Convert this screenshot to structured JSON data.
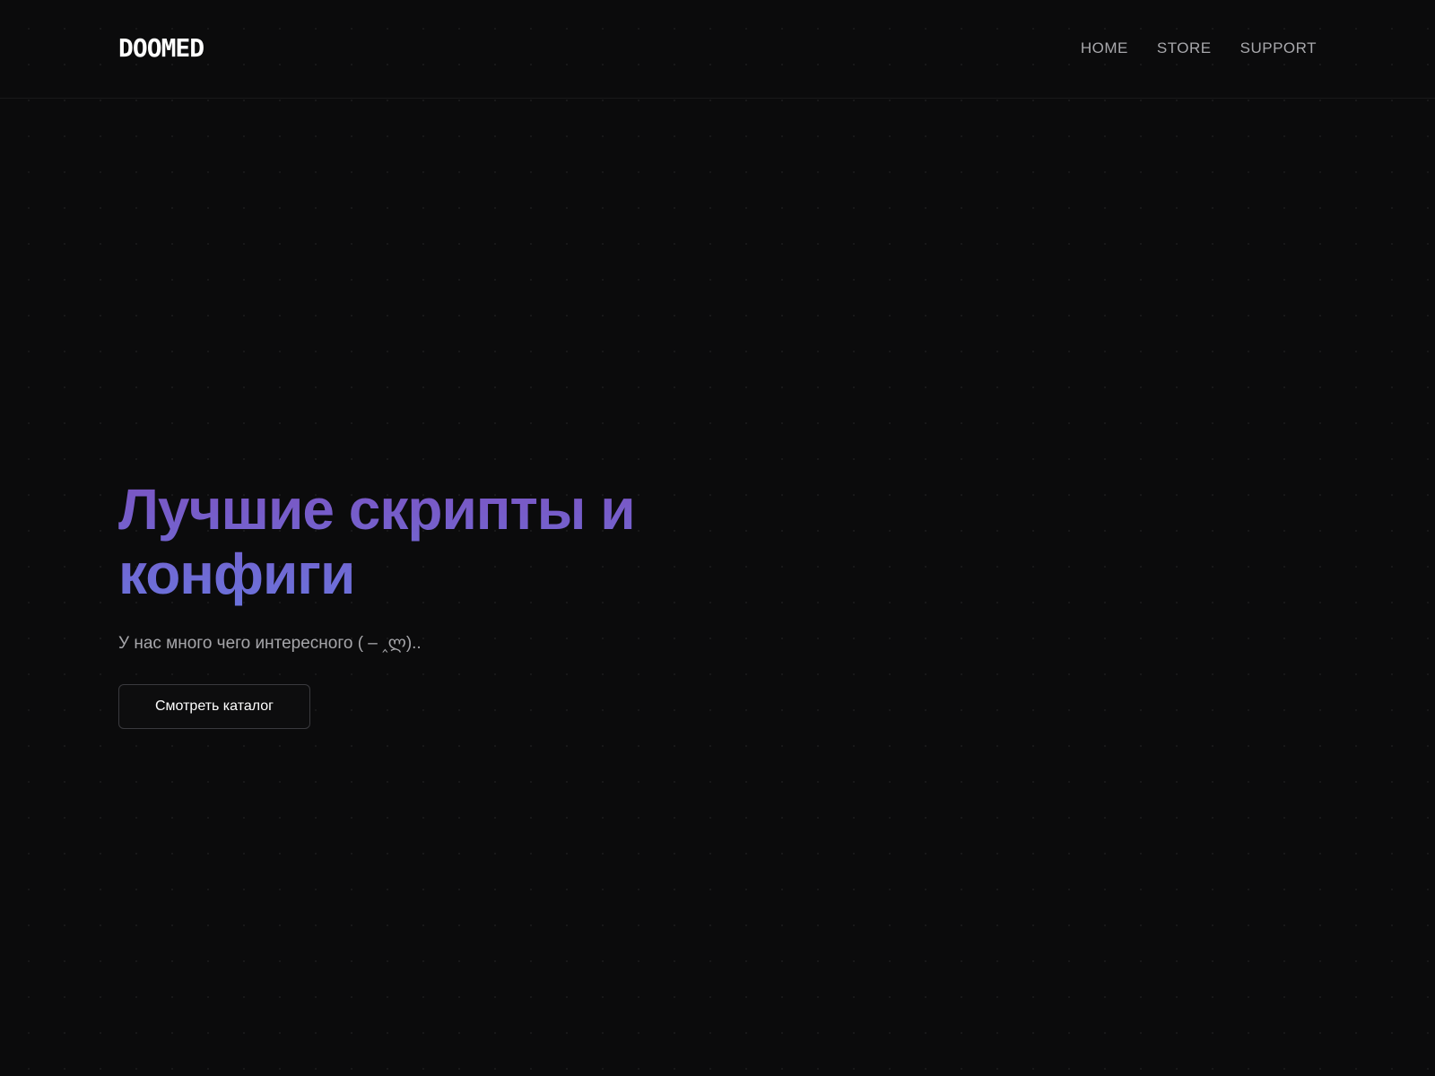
{
  "header": {
    "logo": "DOOMED",
    "nav": [
      {
        "label": "HOME"
      },
      {
        "label": "STORE"
      },
      {
        "label": "SUPPORT"
      }
    ]
  },
  "hero": {
    "title": "Лучшие скрипты и конфиги",
    "subtitle": "У нас много чего интересного ( – ‸ლ)..",
    "button_label": "Смотреть каталог",
    "title_gradient": [
      "#7b54c2",
      "#6b72db"
    ]
  },
  "colors": {
    "background": "#0b0b0c",
    "text_primary": "#ffffff",
    "text_muted": "#a6a6aa",
    "button_border": "#3a3a3e"
  }
}
